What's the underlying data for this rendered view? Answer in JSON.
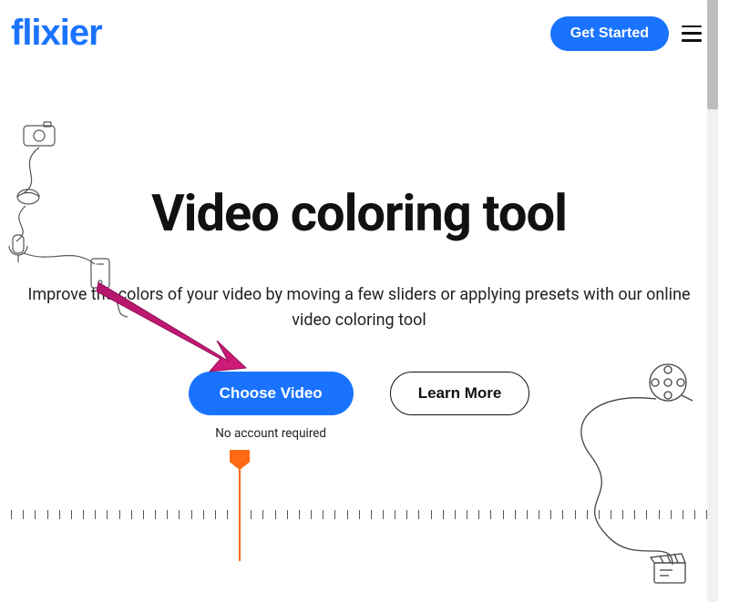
{
  "header": {
    "logo_text": "flixier",
    "get_started_label": "Get Started"
  },
  "hero": {
    "headline": "Video coloring tool",
    "subhead": "Improve the colors of your video by moving a few sliders or applying presets with our online video coloring tool",
    "choose_label": "Choose Video",
    "choose_helper": "No account required",
    "learn_more_label": "Learn More"
  },
  "colors": {
    "accent": "#1a73ff",
    "playhead": "#ff6a13",
    "arrow": "#b3166b"
  }
}
